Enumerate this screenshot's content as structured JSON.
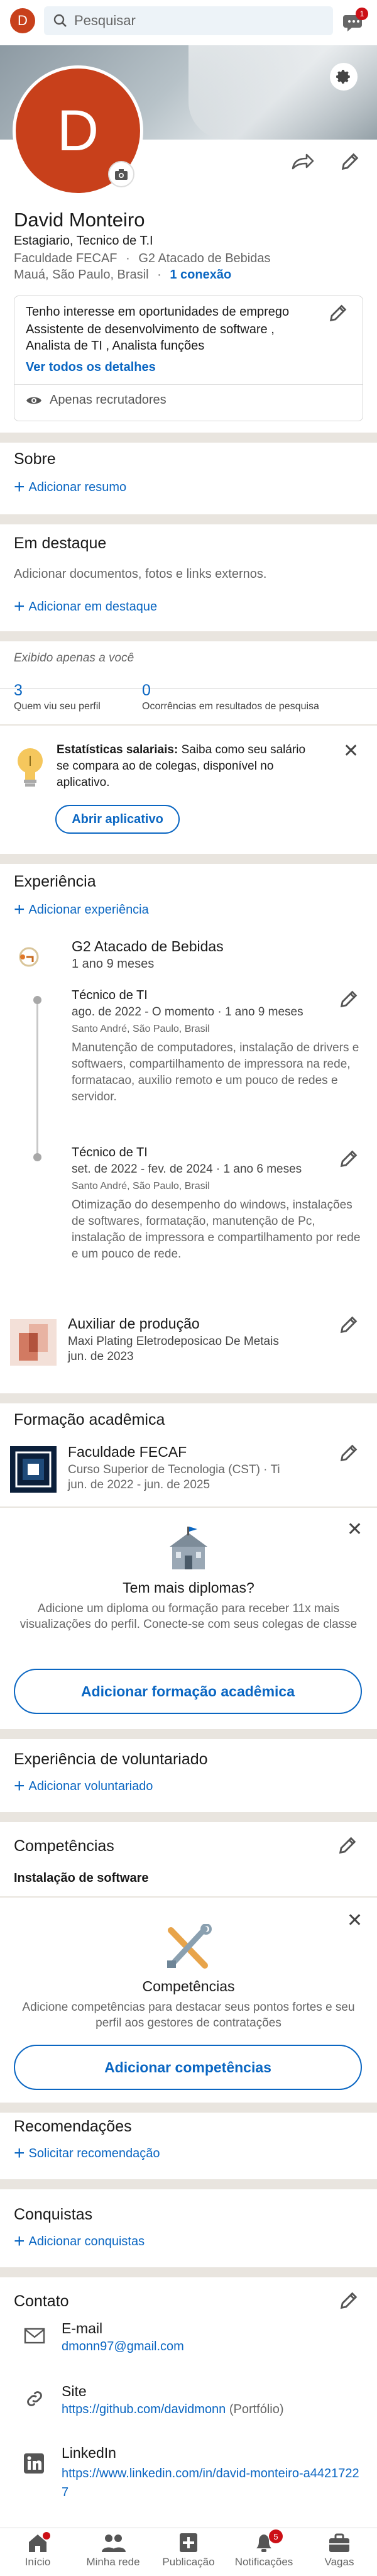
{
  "topbar": {
    "avatar_letter": "D",
    "search_placeholder": "Pesquisar",
    "messages_badge": "1"
  },
  "profile": {
    "avatar_letter": "D",
    "name": "David Monteiro",
    "headline": "Estagiario, Tecnico de T.I",
    "education": "Faculdade FECAF",
    "dot": "·",
    "company": "G2 Atacado de Bebidas",
    "location": "Mauá, São Paulo, Brasil",
    "connections": "1 conexão"
  },
  "open_to_work": {
    "title": "Tenho interesse em oportunidades de emprego",
    "roles": "Assistente de desenvolvimento de software , Analista de TI , Analista funções",
    "see_all": "Ver todos os detalhes",
    "visibility": "Apenas recrutadores"
  },
  "about": {
    "title": "Sobre",
    "add_label": "Adicionar resumo"
  },
  "featured": {
    "title": "Em destaque",
    "description": "Adicionar documentos, fotos e links externos.",
    "add_label": "Adicionar em destaque"
  },
  "analytics": {
    "private_note": "Exibido apenas a você",
    "profile_views_count": "3",
    "profile_views_label": "Quem viu seu perfil",
    "search_count": "0",
    "search_label": "Ocorrências em resultados de pesquisa"
  },
  "salary_banner": {
    "title": "Estatísticas salariais:",
    "text": " Saiba como seu salário se compara ao de colegas, disponível no aplicativo.",
    "button": "Abrir aplicativo"
  },
  "experience": {
    "title": "Experiência",
    "add_label": "Adicionar experiência",
    "company1": {
      "name": "G2 Atacado de Bebidas",
      "duration": "1 ano 9 meses",
      "roles": [
        {
          "title": "Técnico de TI",
          "dates": "ago. de 2022 - O momento · 1 ano 9 meses",
          "location": "Santo André, São Paulo, Brasil",
          "description": "Manutenção de computadores, instalação de drivers e softwaers, compartilhamento de impressora na rede, formatacao, auxilio remoto e um pouco de redes e servidor."
        },
        {
          "title": "Técnico de TI",
          "dates": "set. de 2022 - fev. de 2024 · 1 ano 6 meses",
          "location": "Santo André, São Paulo, Brasil",
          "description": "Otimização do desempenho do windows, instalações de softwares, formatação, manutenção de Pc, instalação de impressora e compartilhamento por rede e um pouco de rede."
        }
      ]
    },
    "company2": {
      "title": "Auxiliar de produção",
      "company": "Maxi Plating Eletrodeposicao De Metais",
      "dates": "jun. de 2023"
    }
  },
  "education_section": {
    "title": "Formação acadêmica",
    "school": "Faculdade FECAF",
    "degree": "Curso Superior de Tecnologia (CST) · Ti",
    "dates": "jun. de 2022 - jun. de 2025"
  },
  "more_degrees": {
    "title": "Tem mais diplomas?",
    "text": "Adicione um diploma ou formação para receber 11x mais visualizações do perfil. Conecte-se com seus colegas de classe",
    "button": "Adicionar formação acadêmica"
  },
  "volunteer": {
    "title": "Experiência de voluntariado",
    "add_label": "Adicionar voluntariado"
  },
  "skills": {
    "title": "Competências",
    "item": "Instalação de software",
    "promo_title": "Competências",
    "promo_text": "Adicione competências para destacar seus pontos fortes e seu perfil aos gestores de contratações",
    "button": "Adicionar competências"
  },
  "recommendations": {
    "title": "Recomendações",
    "add_label": "Solicitar recomendação"
  },
  "achievements": {
    "title": "Conquistas",
    "add_label": "Adicionar conquistas"
  },
  "contact": {
    "title": "Contato",
    "email_label": "E-mail",
    "email": "dmonn97@gmail.com",
    "site_label": "Site",
    "site_url": "https://github.com/davidmonn",
    "site_type": "(Portfólio)",
    "linkedin_label": "LinkedIn",
    "linkedin_url": "https://www.linkedin.com/in/david-monteiro-a44217227"
  },
  "nav": {
    "home": "Início",
    "network": "Minha rede",
    "post": "Publicação",
    "notifications": "Notificações",
    "notifications_badge": "5",
    "jobs": "Vagas"
  },
  "colors": {
    "accent": "#0a66c2",
    "avatar": "#c8401b",
    "badge": "#cc1016"
  }
}
